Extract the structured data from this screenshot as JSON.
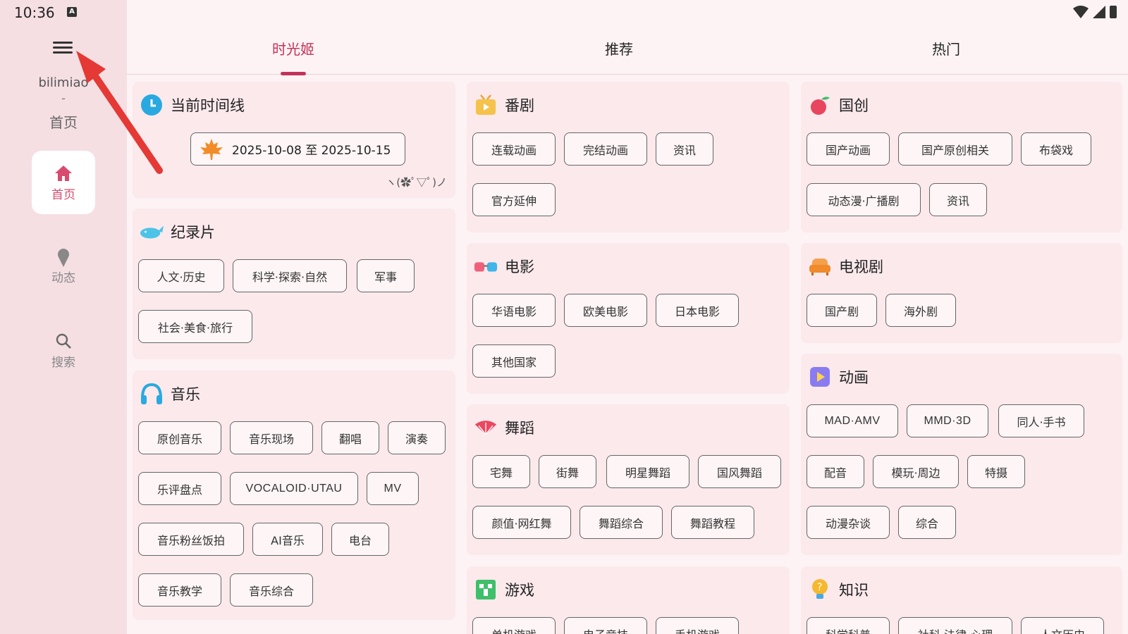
{
  "status": {
    "time": "10:36",
    "input_indicator": "A"
  },
  "sidebar": {
    "app_name": "bilimiao",
    "separator": "-",
    "page": "首页",
    "items": [
      {
        "label": "首页",
        "icon": "home-icon"
      },
      {
        "label": "动态",
        "icon": "icecream-icon"
      },
      {
        "label": "搜索",
        "icon": "search-icon"
      }
    ]
  },
  "tabs": [
    "时光姬",
    "推荐",
    "热门"
  ],
  "timeline": {
    "title": "当前时间线",
    "date_range": "2025-10-08 至 2025-10-15",
    "kaomoji": "ヽ(✿ﾟ▽ﾟ)ノ"
  },
  "cards": {
    "documentary": {
      "title": "纪录片",
      "chips": [
        "人文·历史",
        "科学·探索·自然",
        "军事",
        "社会·美食·旅行"
      ]
    },
    "music": {
      "title": "音乐",
      "chips": [
        "原创音乐",
        "音乐现场",
        "翻唱",
        "演奏",
        "乐评盘点",
        "VOCALOID·UTAU",
        "MV",
        "音乐粉丝饭拍",
        "AI音乐",
        "电台",
        "音乐教学",
        "音乐综合"
      ]
    },
    "anime": {
      "title": "番剧",
      "chips": [
        "连载动画",
        "完结动画",
        "资讯",
        "官方延伸"
      ]
    },
    "movie": {
      "title": "电影",
      "chips": [
        "华语电影",
        "欧美电影",
        "日本电影",
        "其他国家"
      ]
    },
    "dance": {
      "title": "舞蹈",
      "chips": [
        "宅舞",
        "街舞",
        "明星舞蹈",
        "国风舞蹈",
        "颜值·网红舞",
        "舞蹈综合",
        "舞蹈教程"
      ]
    },
    "game": {
      "title": "游戏",
      "chips": [
        "单机游戏",
        "电子竞技",
        "手机游戏"
      ]
    },
    "guochuang": {
      "title": "国创",
      "chips": [
        "国产动画",
        "国产原创相关",
        "布袋戏",
        "动态漫·广播剧",
        "资讯"
      ]
    },
    "tv": {
      "title": "电视剧",
      "chips": [
        "国产剧",
        "海外剧"
      ]
    },
    "animation": {
      "title": "动画",
      "chips": [
        "MAD·AMV",
        "MMD·3D",
        "同人·手书",
        "配音",
        "模玩·周边",
        "特摄",
        "动漫杂谈",
        "综合"
      ]
    },
    "knowledge": {
      "title": "知识",
      "chips": [
        "科学科普",
        "社科·法律·心理",
        "人文历史"
      ]
    }
  },
  "colors": {
    "accent": "#c2335a",
    "sidebar_bg": "#f5dfe3",
    "card_bg": "#fbe9ec",
    "arrow": "#e53935"
  }
}
